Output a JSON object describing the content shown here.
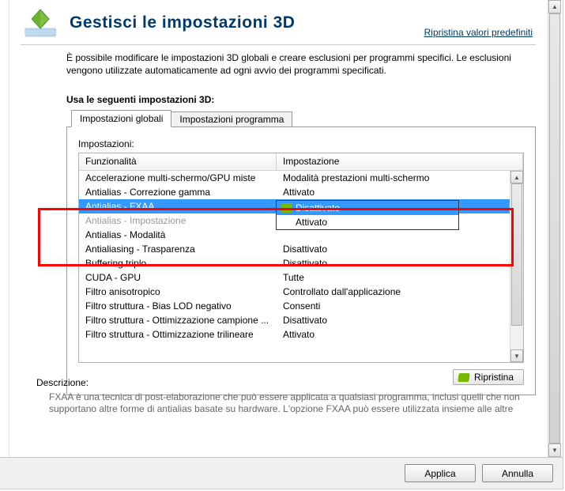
{
  "header": {
    "title": "Gestisci le impostazioni 3D",
    "restore_defaults": "Ripristina valori predefiniti"
  },
  "intro": "È possibile modificare le impostazioni 3D globali e creare esclusioni per programmi specifici. Le esclusioni vengono utilizzate automaticamente ad ogni avvio dei programmi specificati.",
  "section_title": "Usa le seguenti impostazioni 3D:",
  "tabs": {
    "global": "Impostazioni globali",
    "program": "Impostazioni programma"
  },
  "settings_label": "Impostazioni:",
  "columns": {
    "feature": "Funzionalità",
    "setting": "Impostazione"
  },
  "rows": [
    {
      "feature": "Accelerazione multi-schermo/GPU miste",
      "setting": "Modalità prestazioni multi-schermo"
    },
    {
      "feature": "Antialias - Correzione gamma",
      "setting": "Attivato"
    },
    {
      "feature": "Antialias - FXAA",
      "setting": "Disattivato",
      "selected": true
    },
    {
      "feature": "Antialias - Impostazione",
      "setting": "",
      "disabled": true
    },
    {
      "feature": "Antialias - Modalità",
      "setting": ""
    },
    {
      "feature": "Antialiasing - Trasparenza",
      "setting": "Disattivato"
    },
    {
      "feature": "Buffering triplo",
      "setting": "Disattivato"
    },
    {
      "feature": "CUDA - GPU",
      "setting": "Tutte"
    },
    {
      "feature": "Filtro anisotropico",
      "setting": "Controllato dall'applicazione"
    },
    {
      "feature": "Filtro struttura - Bias LOD negativo",
      "setting": "Consenti"
    },
    {
      "feature": "Filtro struttura - Ottimizzazione campione ...",
      "setting": "Disattivato"
    },
    {
      "feature": "Filtro struttura - Ottimizzazione trilineare",
      "setting": "Attivato"
    }
  ],
  "dropdown": {
    "options": [
      "Disattivato",
      "Attivato"
    ],
    "selected": "Disattivato"
  },
  "restore_btn": "Ripristina",
  "description": {
    "label": "Descrizione:",
    "text": "FXAA è una tecnica di post-elaborazione che può essere applicata a qualsiasi programma, inclusi quelli che non supportano altre forme di antialias basate su hardware. L'opzione FXAA può essere utilizzata insieme alle altre"
  },
  "buttons": {
    "apply": "Applica",
    "cancel": "Annulla"
  }
}
